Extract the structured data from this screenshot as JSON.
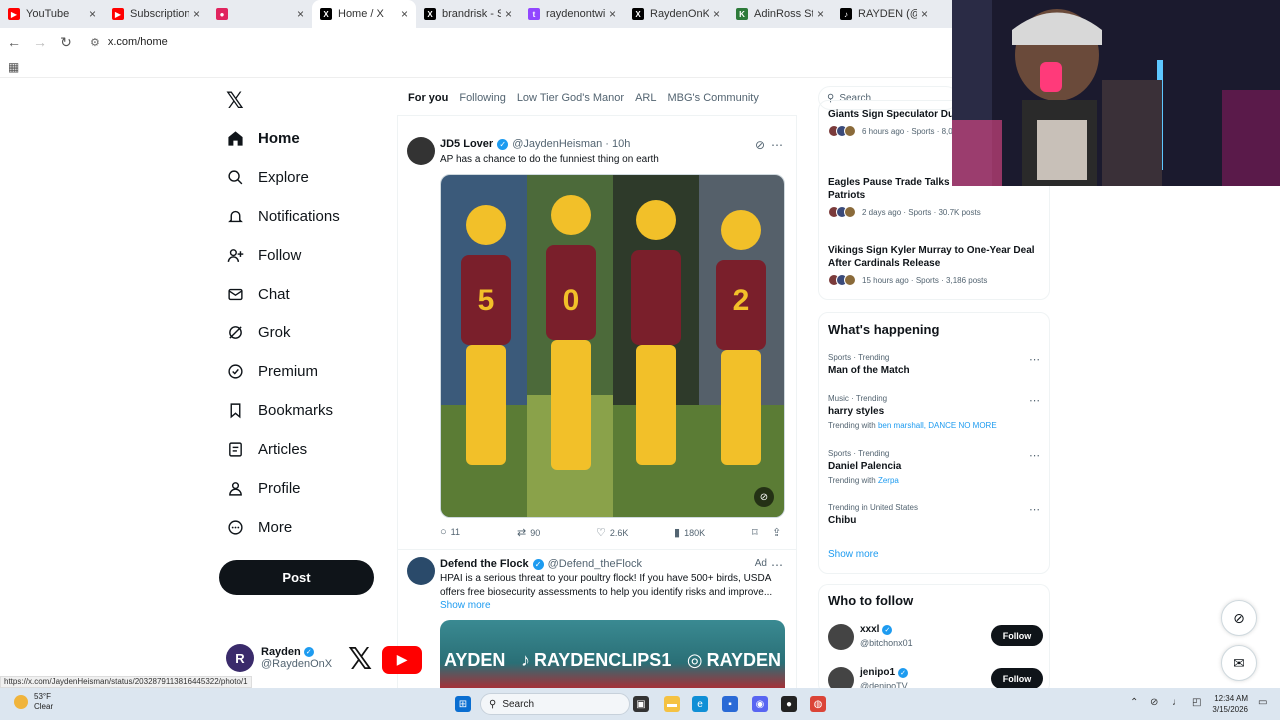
{
  "browser": {
    "tabs": [
      {
        "label": "YouTube",
        "color": "#ff0000",
        "glyph": "▶"
      },
      {
        "label": "Subscriptions -",
        "color": "#ff0000",
        "glyph": "▶"
      },
      {
        "label": "",
        "color": "#e0245e",
        "glyph": "●"
      },
      {
        "label": "Home / X",
        "color": "#000000",
        "glyph": "X",
        "active": true
      },
      {
        "label": "brandrisk - Sea",
        "color": "#000000",
        "glyph": "X"
      },
      {
        "label": "raydenontwitch",
        "color": "#9146ff",
        "glyph": "t"
      },
      {
        "label": "RaydenOnKick",
        "color": "#000000",
        "glyph": "X"
      },
      {
        "label": "AdinRoss Stream",
        "color": "#2d7a3a",
        "glyph": "K"
      },
      {
        "label": "RAYDEN (@ray",
        "color": "#000000",
        "glyph": "♪"
      }
    ],
    "url": "x.com/home"
  },
  "nav": {
    "logo": "𝕏",
    "items": [
      {
        "label": "Home",
        "icon": "home-icon"
      },
      {
        "label": "Explore",
        "icon": "search-icon"
      },
      {
        "label": "Notifications",
        "icon": "bell-icon"
      },
      {
        "label": "Follow",
        "icon": "follow-icon"
      },
      {
        "label": "Chat",
        "icon": "mail-icon"
      },
      {
        "label": "Grok",
        "icon": "grok-icon"
      },
      {
        "label": "Premium",
        "icon": "premium-icon"
      },
      {
        "label": "Bookmarks",
        "icon": "bookmark-icon"
      },
      {
        "label": "Articles",
        "icon": "article-icon"
      },
      {
        "label": "Profile",
        "icon": "profile-icon"
      },
      {
        "label": "More",
        "icon": "more-icon"
      }
    ],
    "post_label": "Post",
    "account": {
      "name": "Rayden",
      "handle": "@RaydenOnX",
      "initial": "R"
    }
  },
  "feed": {
    "tabs": [
      "For you",
      "Following",
      "Low Tier God's Manor",
      "ARL",
      "MBG's Community"
    ],
    "tweet1": {
      "name": "JD5 Lover",
      "handle": "@JaydenHeisman",
      "time": "· 10h",
      "text": "AP has a chance to do the funniest thing on earth",
      "jersey_numbers": [
        "5",
        "0",
        "",
        "2"
      ],
      "replies": "11",
      "reposts": "90",
      "likes": "2.6K",
      "views": "180K"
    },
    "tweet2": {
      "name": "Defend the Flock",
      "handle": "@Defend_theFlock",
      "ad_label": "Ad",
      "text": "HPAI is a serious threat to your poultry flock! If you have 500+ birds, USDA offers free biosecurity assessments to help you identify risks and improve...",
      "show_more": "Show more",
      "banner": [
        "AYDEN",
        "RAYDENCLIPS1",
        "RAYDEN"
      ]
    }
  },
  "right": {
    "search_placeholder": "Search",
    "news": [
      {
        "title": "Giants Sign Speculator Du... $10M Deal",
        "meta": "6 hours ago · Sports · 8,0"
      },
      {
        "title": "Eagles Pause Trade Talks ... with Rams and Patriots",
        "meta": "2 days ago · Sports · 30.7K posts"
      },
      {
        "title": "Vikings Sign Kyler Murray to One-Year Deal After Cardinals Release",
        "meta": "15 hours ago · Sports · 3,186 posts"
      }
    ],
    "happening_title": "What's happening",
    "trends": [
      {
        "category": "Sports · Trending",
        "title": "Man of the Match",
        "with": "",
        "links": ""
      },
      {
        "category": "Music · Trending",
        "title": "harry styles",
        "with": "Trending with",
        "links": "ben marshall, DANCE NO MORE"
      },
      {
        "category": "Sports · Trending",
        "title": "Daniel Palencia",
        "with": "Trending with",
        "links": "Zerpa"
      },
      {
        "category": "Trending in United States",
        "title": "Chibu",
        "with": "",
        "links": ""
      }
    ],
    "show_more": "Show more",
    "who_to_follow_title": "Who to follow",
    "follow": [
      {
        "name": "xxxl",
        "handle": "@bitchonx01",
        "button": "Follow"
      },
      {
        "name": "jenipo1",
        "handle": "@denipoTV",
        "button": "Follow"
      }
    ]
  },
  "status_url": "https://x.com/JaydenHeisman/status/2032879113816445322/photo/1",
  "taskbar": {
    "temp": "53°F",
    "condition": "Clear",
    "search": "Search",
    "time": "12:34 AM",
    "date": "3/15/2026"
  },
  "colors": {
    "accent": "#1d9bf0",
    "text": "#0f1419",
    "muted": "#536471"
  }
}
